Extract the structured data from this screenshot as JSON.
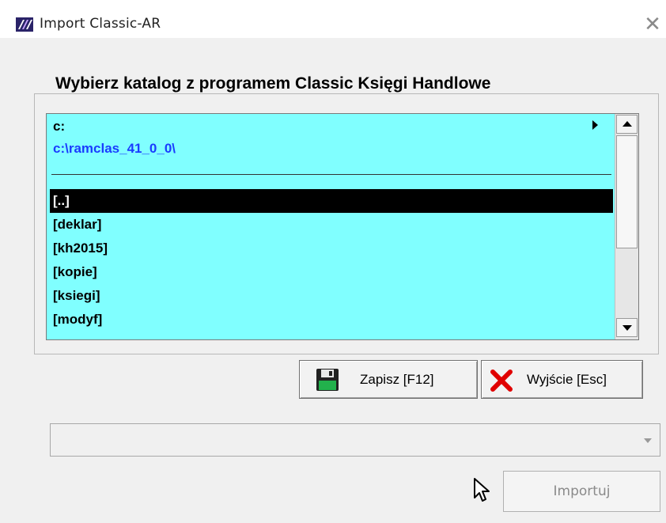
{
  "window": {
    "title": "Import Classic-AR",
    "close_label": "✕"
  },
  "group": {
    "legend": "Wybierz katalog z programem Classic Księgi Handlowe"
  },
  "listbox": {
    "drive": "c:",
    "current_path": "c:\\ramclas_41_0_0\\",
    "entries": [
      {
        "label": "[..]",
        "selected": true
      },
      {
        "label": "[deklar]",
        "selected": false
      },
      {
        "label": "[kh2015]",
        "selected": false
      },
      {
        "label": "[kopie]",
        "selected": false
      },
      {
        "label": "[ksiegi]",
        "selected": false
      },
      {
        "label": "[modyf]",
        "selected": false
      }
    ]
  },
  "buttons": {
    "save_label": "Zapisz  [F12]",
    "exit_label": "Wyjście  [Esc]",
    "import_label": "Importuj"
  },
  "combo": {
    "value": ""
  },
  "colors": {
    "list_background": "#80ffff",
    "path_text": "#1a3cff",
    "selected_row": "#000000",
    "save_icon_green": "#22b14c",
    "exit_icon_red": "#e00000"
  }
}
